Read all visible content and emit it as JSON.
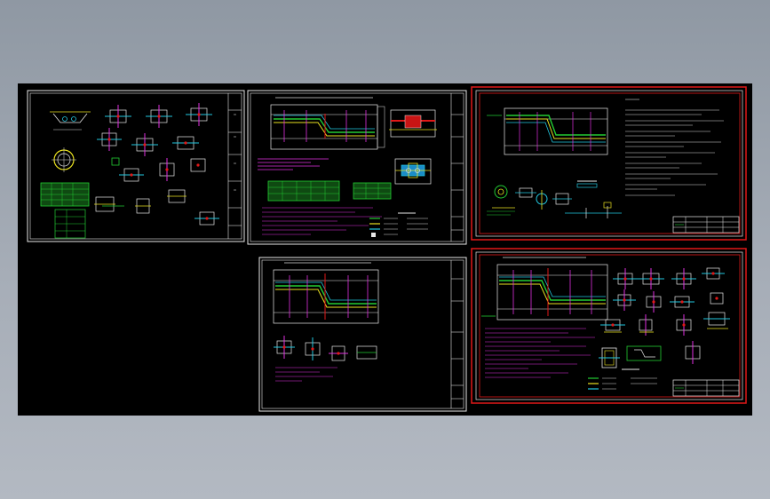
{
  "viewport": {
    "background": "#000000",
    "sheets": [
      {
        "id": "sheet-1",
        "frame_color": "#e8e8e8",
        "highlight_color": null
      },
      {
        "id": "sheet-2",
        "frame_color": "#e8e8e8",
        "highlight_color": null
      },
      {
        "id": "sheet-3",
        "frame_color": "#e8e8e8",
        "highlight_color": "#e01818"
      },
      {
        "id": "sheet-4",
        "frame_color": "#e8e8e8",
        "highlight_color": null
      },
      {
        "id": "sheet-5",
        "frame_color": "#e8e8e8",
        "highlight_color": "#e01818"
      }
    ]
  },
  "colors": {
    "frame": "#e8e8e8",
    "pipe_green": "#22cc33",
    "pipe_yellow": "#e8e020",
    "pipe_cyan": "#22c8e0",
    "annotation_magenta": "#e030e0",
    "text_white": "#d8d8d8",
    "highlight_red": "#e01818"
  }
}
